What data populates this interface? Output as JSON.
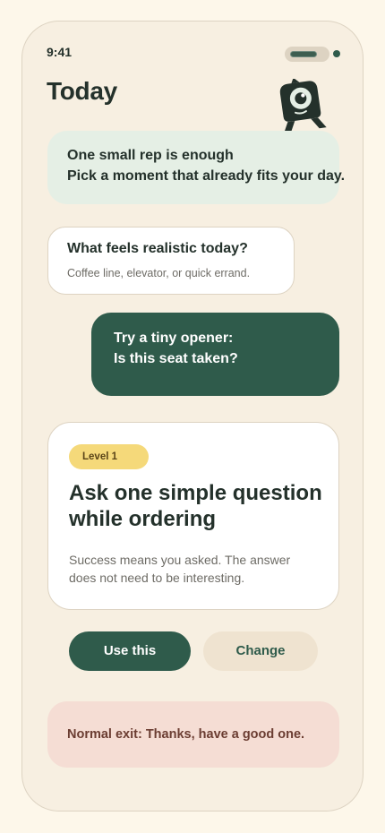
{
  "status_bar": {
    "time": "9:41"
  },
  "header": {
    "title": "Today",
    "mascot_icon": "one-eyed-mascot-icon"
  },
  "tip_card": {
    "line1": "One small rep is enough",
    "line2": "Pick a moment that already fits your day."
  },
  "question_card": {
    "title": "What feels realistic today?",
    "subtitle": "Coffee line, elevator, or quick errand."
  },
  "opener_card": {
    "line1": "Try a tiny opener:",
    "line2": "Is this seat taken?"
  },
  "level_card": {
    "badge": "Level 1",
    "heading": "Ask one simple question while ordering",
    "description": "Success means you asked. The answer does not need to be interesting."
  },
  "actions": {
    "primary_label": "Use this",
    "secondary_label": "Change"
  },
  "exit_card": {
    "text": "Normal exit: Thanks, have a good one."
  },
  "colors": {
    "background": "#fdf7ea",
    "device": "#f7efe1",
    "primary": "#2f5b4b",
    "text": "#24312b",
    "tip_bg": "#e5efe5",
    "badge_bg": "#f5d97a",
    "exit_bg": "#f5ddd4",
    "secondary_btn_bg": "#efe3d0"
  }
}
